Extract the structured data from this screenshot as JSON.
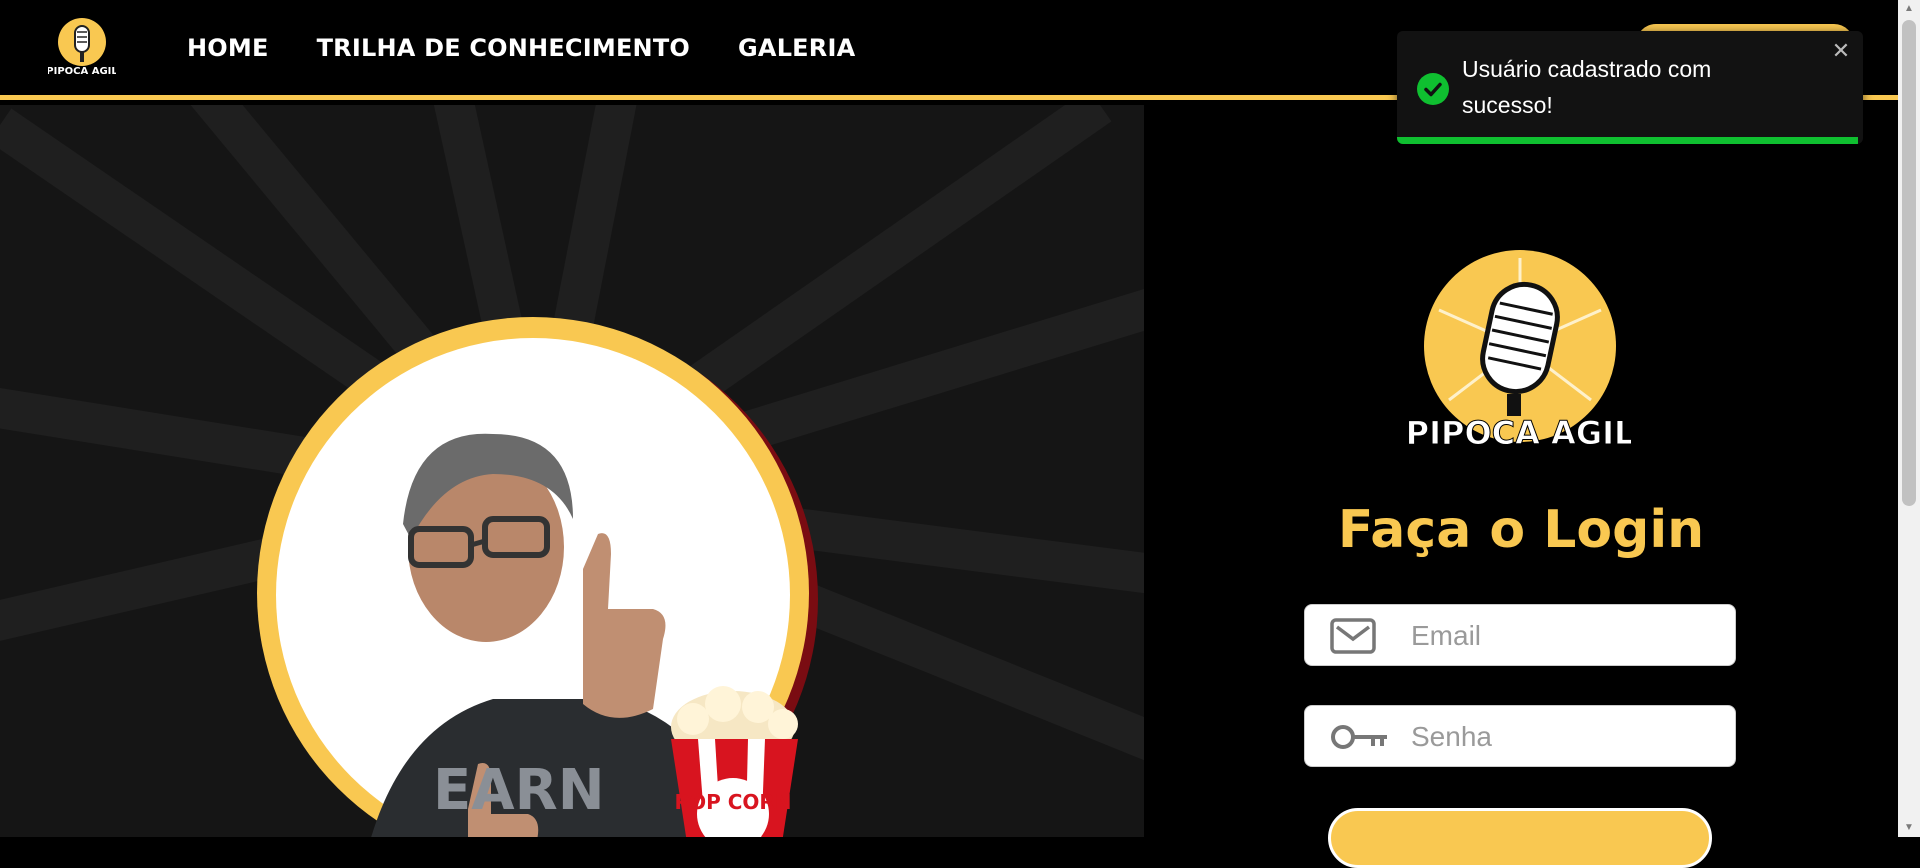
{
  "nav": {
    "home": "HOME",
    "trilha": "TRILHA DE CONHECIMENTO",
    "galeria": "GALERIA"
  },
  "logo": {
    "text": "PIPOCA AGIL"
  },
  "login": {
    "title": "Faça o Login",
    "email_placeholder": "Email",
    "password_placeholder": "Senha"
  },
  "toast": {
    "message": "Usuário cadastrado com sucesso!",
    "progress": 0.99
  },
  "hero": {
    "popcorn_label": "POP CORN"
  },
  "colors": {
    "accent": "#f9c851",
    "success": "#0fbf30",
    "popcorn_red": "#d8141f"
  },
  "icons": {
    "email": "envelope-icon",
    "password": "key-icon",
    "success": "check-circle-icon",
    "close": "close-icon"
  }
}
